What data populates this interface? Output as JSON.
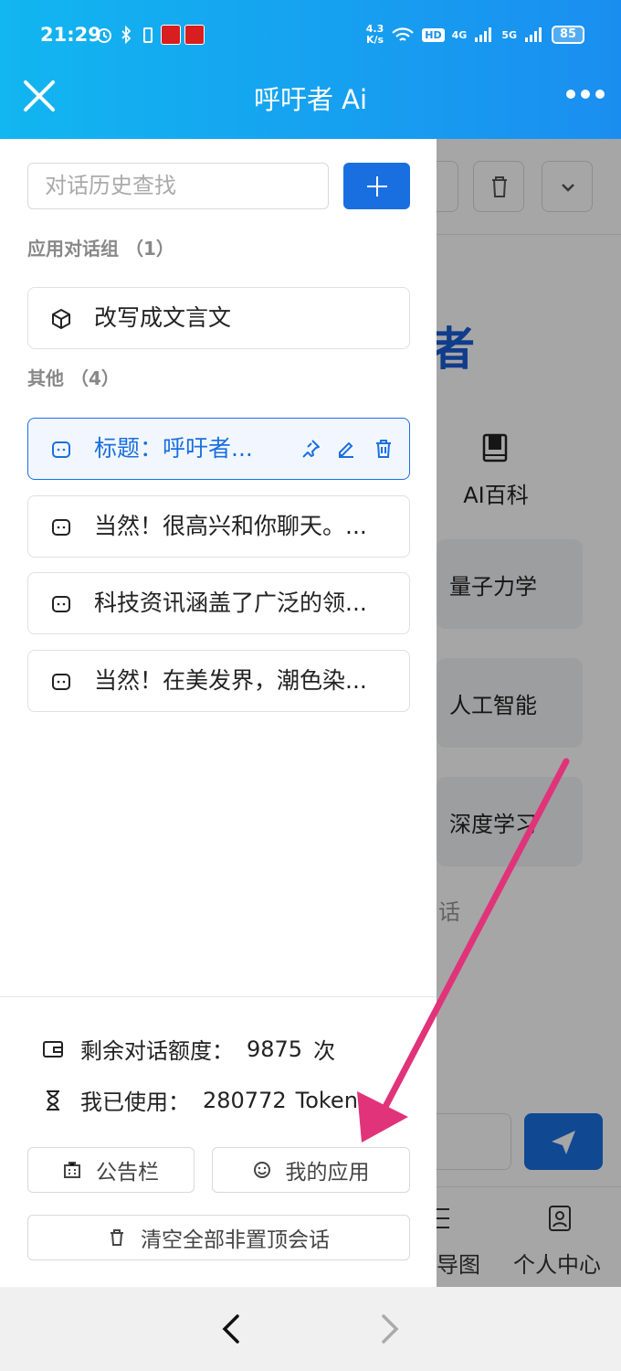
{
  "status_bar": {
    "time": "21:29",
    "net_speed_value": "4.3",
    "net_speed_unit": "K/s",
    "hd": "HD",
    "signal_1": "4G",
    "signal_2": "5G",
    "battery": "85"
  },
  "header": {
    "title": "呼吁者 Ai",
    "close_icon": "close-icon",
    "more_icon": "more-dots-icon"
  },
  "drawer": {
    "search_placeholder": "对话历史查找",
    "app_group_label": "应用对话组 （1）",
    "app_items": [
      {
        "title": "改写成文言文",
        "icon": "cube-icon"
      }
    ],
    "other_group_label": "其他 （4）",
    "other_items": [
      {
        "title": "标题：呼吁者...",
        "icon": "chat-icon",
        "active": true
      },
      {
        "title": "当然！很高兴和你聊天。...",
        "icon": "chat-icon"
      },
      {
        "title": "科技资讯涵盖了广泛的领...",
        "icon": "chat-icon"
      },
      {
        "title": "当然！在美发界，潮色染...",
        "icon": "chat-icon"
      }
    ],
    "quota_label": "剩余对话额度：",
    "quota_value": "9875",
    "quota_unit": "次",
    "used_label": "我已使用：",
    "used_value": "280772",
    "used_unit": "Token",
    "notice_button": "公告栏",
    "my_apps_button": "我的应用",
    "clear_button": "清空全部非置顶会话"
  },
  "background_page": {
    "heading_fragment": "者",
    "encyclopedia_label": "AI百科",
    "cards": [
      "量子力学",
      "人工智能",
      "深度学习"
    ],
    "hint_fragment": "话",
    "nav_labels": [
      "导图",
      "个人中心"
    ]
  },
  "colors": {
    "header_gradient_start": "#12b6f0",
    "header_gradient_end": "#1a8ef0",
    "accent": "#1a6fe0",
    "annotation_arrow": "#e0337a"
  }
}
